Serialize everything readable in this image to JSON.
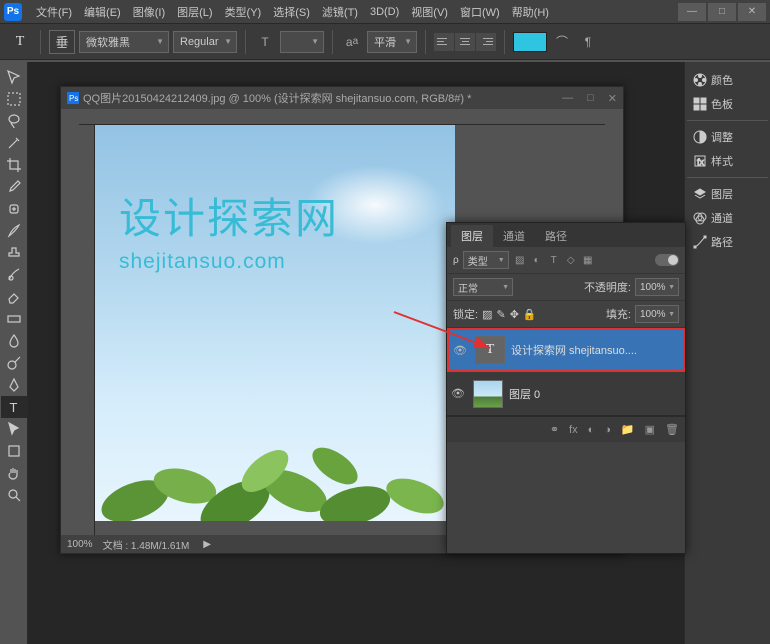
{
  "menu": {
    "items": [
      "文件(F)",
      "编辑(E)",
      "图像(I)",
      "图层(L)",
      "类型(Y)",
      "选择(S)",
      "滤镜(T)",
      "3D(D)",
      "视图(V)",
      "窗口(W)",
      "帮助(H)"
    ]
  },
  "optbar": {
    "font": "微软雅黑",
    "weight": "Regular",
    "aa": "平滑"
  },
  "doc": {
    "title": "QQ图片20150424212409.jpg @ 100% (设计探索网 shejitansuo.com, RGB/8#) *",
    "zoom": "100%",
    "status": "文档 : 1.48M/1.61M"
  },
  "overlay": {
    "main": "设计探索网",
    "sub": "shejitansuo.com"
  },
  "layers": {
    "tabs": [
      "图层",
      "通道",
      "路径"
    ],
    "kind": "类型",
    "blend": "正常",
    "opacityLabel": "不透明度:",
    "opacity": "100%",
    "lockLabel": "锁定:",
    "fillLabel": "填充:",
    "fill": "100%",
    "items": [
      {
        "name": "设计探索网 shejitansuo...."
      },
      {
        "name": "图层 0"
      }
    ]
  },
  "rightPanels": [
    "颜色",
    "色板",
    "调整",
    "样式",
    "图层",
    "通道",
    "路径"
  ]
}
